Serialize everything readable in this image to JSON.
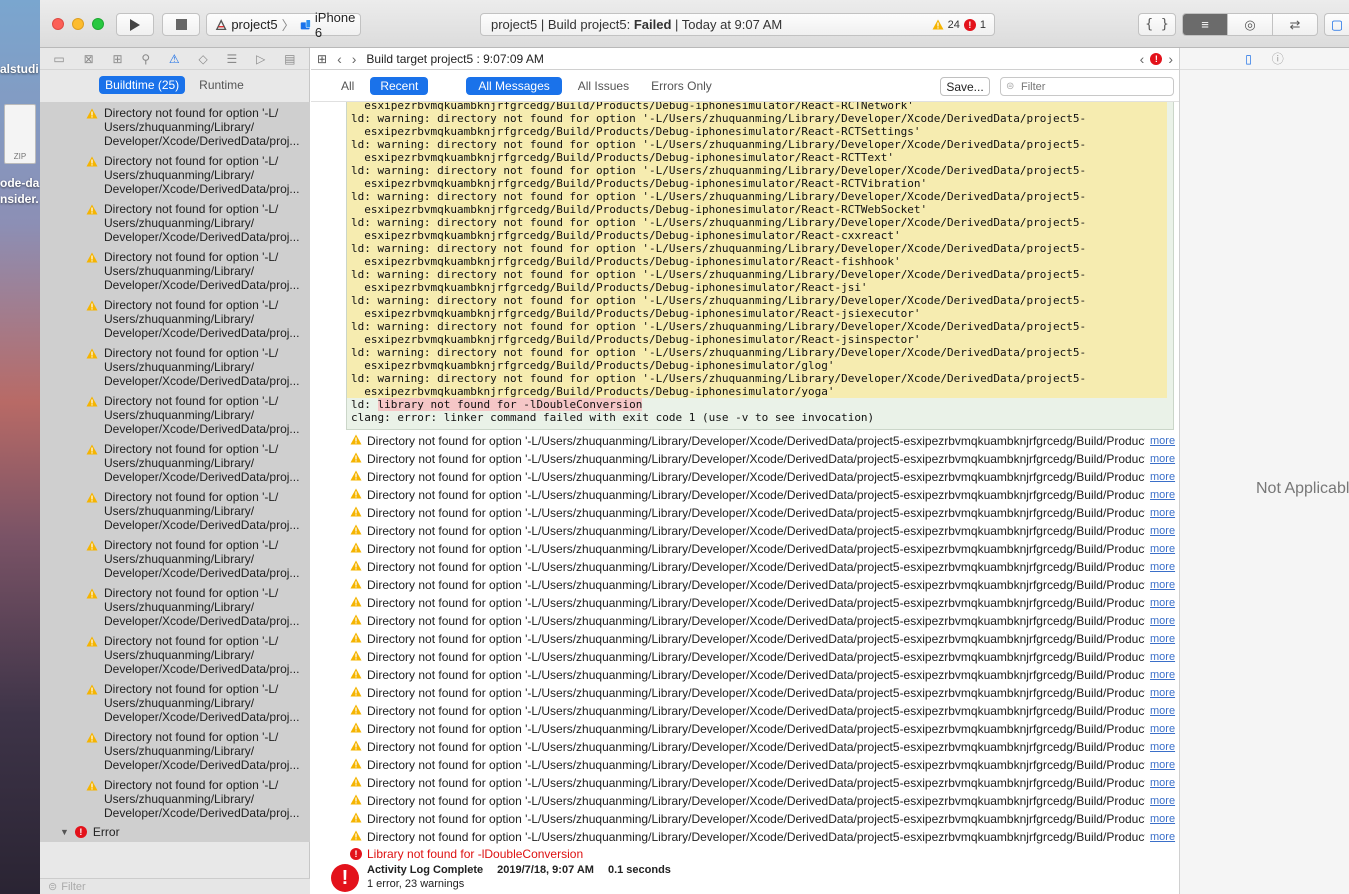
{
  "desktop": {
    "labels": [
      "alstudi",
      "ode-da",
      "nsider."
    ],
    "zip_label": "ZIP"
  },
  "toolbar": {
    "scheme": "project5",
    "device": "iPhone 6",
    "activity_prefix": "project5 | Build project5: ",
    "activity_status": "Failed",
    "activity_suffix": " | Today at 9:07 AM",
    "warning_count": "24",
    "error_count": "1",
    "code_review_label": "{ }"
  },
  "navigator": {
    "filter_tabs": [
      {
        "label": "Buildtime (25)",
        "selected": true
      },
      {
        "label": "Runtime",
        "selected": false
      }
    ],
    "warning_text": "Directory not found for option '-L/ Users/zhuquanming/Library/ Developer/Xcode/DerivedData/proj...",
    "warning_lines": [
      "Directory not found for option '-L/",
      "Users/zhuquanming/Library/",
      "Developer/Xcode/DerivedData/proj..."
    ],
    "error_group_label": "Error",
    "error_item_lines": [
      "Library not found for -",
      "lDoubleConversion"
    ],
    "filter_placeholder": "Filter"
  },
  "editor": {
    "jump_bar_title": "Build target project5 : 9:07:09 AM",
    "scope_tabs": [
      {
        "label": "All",
        "selected": false
      },
      {
        "label": "Recent",
        "selected": true
      }
    ],
    "message_tabs": [
      {
        "label": "All Messages",
        "selected": true
      },
      {
        "label": "All Issues",
        "selected": false
      },
      {
        "label": "Errors Only",
        "selected": false
      }
    ],
    "save_label": "Save...",
    "filter_placeholder": "Filter",
    "transcript_lines": [
      {
        "type": "cont",
        "text": "  esxipezrbvmqkuambknjrfgrcedg/Build/Products/Debug-iphonesimulator/React-RCTNetwork'"
      },
      {
        "type": "warn",
        "text": "directory not found for option '-L/Users/zhuquanming/Library/Developer/Xcode/DerivedData/project5-"
      },
      {
        "type": "cont",
        "text": "  esxipezrbvmqkuambknjrfgrcedg/Build/Products/Debug-iphonesimulator/React-RCTSettings'"
      },
      {
        "type": "warn",
        "text": "directory not found for option '-L/Users/zhuquanming/Library/Developer/Xcode/DerivedData/project5-"
      },
      {
        "type": "cont",
        "text": "  esxipezrbvmqkuambknjrfgrcedg/Build/Products/Debug-iphonesimulator/React-RCTText'"
      },
      {
        "type": "warn",
        "text": "directory not found for option '-L/Users/zhuquanming/Library/Developer/Xcode/DerivedData/project5-"
      },
      {
        "type": "cont",
        "text": "  esxipezrbvmqkuambknjrfgrcedg/Build/Products/Debug-iphonesimulator/React-RCTVibration'"
      },
      {
        "type": "warn",
        "text": "directory not found for option '-L/Users/zhuquanming/Library/Developer/Xcode/DerivedData/project5-"
      },
      {
        "type": "cont",
        "text": "  esxipezrbvmqkuambknjrfgrcedg/Build/Products/Debug-iphonesimulator/React-RCTWebSocket'"
      },
      {
        "type": "warn",
        "text": "directory not found for option '-L/Users/zhuquanming/Library/Developer/Xcode/DerivedData/project5-"
      },
      {
        "type": "cont",
        "text": "  esxipezrbvmqkuambknjrfgrcedg/Build/Products/Debug-iphonesimulator/React-cxxreact'"
      },
      {
        "type": "warn",
        "text": "directory not found for option '-L/Users/zhuquanming/Library/Developer/Xcode/DerivedData/project5-"
      },
      {
        "type": "cont",
        "text": "  esxipezrbvmqkuambknjrfgrcedg/Build/Products/Debug-iphonesimulator/React-fishhook'"
      },
      {
        "type": "warn",
        "text": "directory not found for option '-L/Users/zhuquanming/Library/Developer/Xcode/DerivedData/project5-"
      },
      {
        "type": "cont",
        "text": "  esxipezrbvmqkuambknjrfgrcedg/Build/Products/Debug-iphonesimulator/React-jsi'"
      },
      {
        "type": "warn",
        "text": "directory not found for option '-L/Users/zhuquanming/Library/Developer/Xcode/DerivedData/project5-"
      },
      {
        "type": "cont",
        "text": "  esxipezrbvmqkuambknjrfgrcedg/Build/Products/Debug-iphonesimulator/React-jsiexecutor'"
      },
      {
        "type": "warn",
        "text": "directory not found for option '-L/Users/zhuquanming/Library/Developer/Xcode/DerivedData/project5-"
      },
      {
        "type": "cont",
        "text": "  esxipezrbvmqkuambknjrfgrcedg/Build/Products/Debug-iphonesimulator/React-jsinspector'"
      },
      {
        "type": "warn",
        "text": "directory not found for option '-L/Users/zhuquanming/Library/Developer/Xcode/DerivedData/project5-"
      },
      {
        "type": "cont",
        "text": "  esxipezrbvmqkuambknjrfgrcedg/Build/Products/Debug-iphonesimulator/glog'"
      },
      {
        "type": "warn",
        "text": "directory not found for option '-L/Users/zhuquanming/Library/Developer/Xcode/DerivedData/project5-"
      },
      {
        "type": "cont",
        "text": "  esxipezrbvmqkuambknjrfgrcedg/Build/Products/Debug-iphonesimulator/yoga'"
      },
      {
        "type": "err",
        "text": "library not found for -lDoubleConversion"
      },
      {
        "type": "plain",
        "text": "clang: error: linker command failed with exit code 1 (use -v to see invocation)"
      }
    ],
    "ld_prefix": "ld: ",
    "warning_prefix": "warning: ",
    "issue_row_text": "Directory not found for option '-L/Users/zhuquanming/Library/Developer/Xcode/DerivedData/project5-esxipezrbvmqkuambknjrfgrcedg/Build/Products/...",
    "issue_row_count": 23,
    "more_label": "more",
    "error_row_text": "Library not found for -lDoubleConversion",
    "complete_title": "Activity Log Complete",
    "complete_date": "2019/7/18, 9:07 AM",
    "complete_duration": "0.1 seconds",
    "complete_summary": "1 error, 23 warnings"
  },
  "inspector": {
    "placeholder": "Not Applicable"
  },
  "colors": {
    "accent": "#1a72ea",
    "warning": "#f5b400",
    "error": "#e3121b"
  }
}
